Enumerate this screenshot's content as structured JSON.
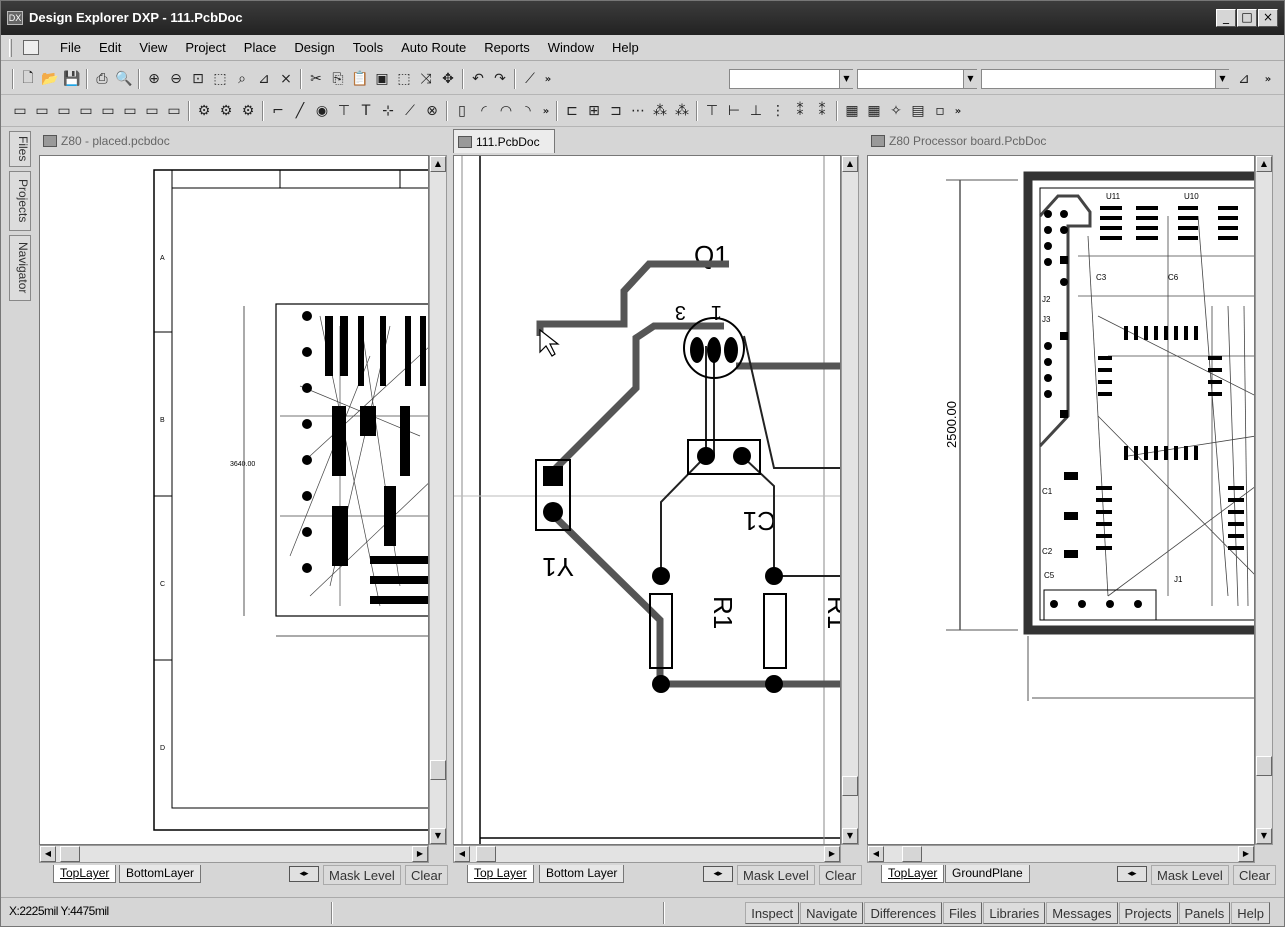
{
  "window": {
    "title": "Design Explorer DXP - 111.PcbDoc",
    "controls": [
      "_",
      "□",
      "×"
    ]
  },
  "menu": [
    "File",
    "Edit",
    "View",
    "Project",
    "Place",
    "Design",
    "Tools",
    "Auto Route",
    "Reports",
    "Window",
    "Help"
  ],
  "side_panels": [
    "Files",
    "Projects",
    "Navigator"
  ],
  "panes": {
    "left": {
      "tab": "Z80 - placed.pcbdoc",
      "zones": [
        "A",
        "B",
        "C",
        "D"
      ],
      "dimension": "3640.00",
      "layers": [
        "TopLayer",
        "BottomLayer"
      ]
    },
    "center": {
      "tab": "111.PcbDoc",
      "labels": {
        "q1": "Q1",
        "pin3": "3",
        "pin1": "1",
        "c1": "C1",
        "y1": "Y1",
        "r1": "R1",
        "r_partial": "R1"
      },
      "layers": [
        "Top Layer",
        "Bottom Layer"
      ]
    },
    "right": {
      "tab": "Z80 Processor board.PcbDoc",
      "dimension": "2500.00",
      "refs": [
        "U11",
        "U10",
        "C3",
        "C6",
        "J2",
        "J3",
        "C1",
        "C2",
        "C5",
        "J1"
      ],
      "layers": [
        "TopLayer",
        "GroundPlane"
      ]
    }
  },
  "layer_controls": {
    "mask": "Mask Level",
    "clear": "Clear"
  },
  "status": {
    "coords": "X:2225mil Y:4475mil",
    "buttons": [
      "Inspect",
      "Navigate",
      "Differences",
      "Files",
      "Libraries",
      "Messages",
      "Projects",
      "Panels",
      "Help"
    ]
  }
}
